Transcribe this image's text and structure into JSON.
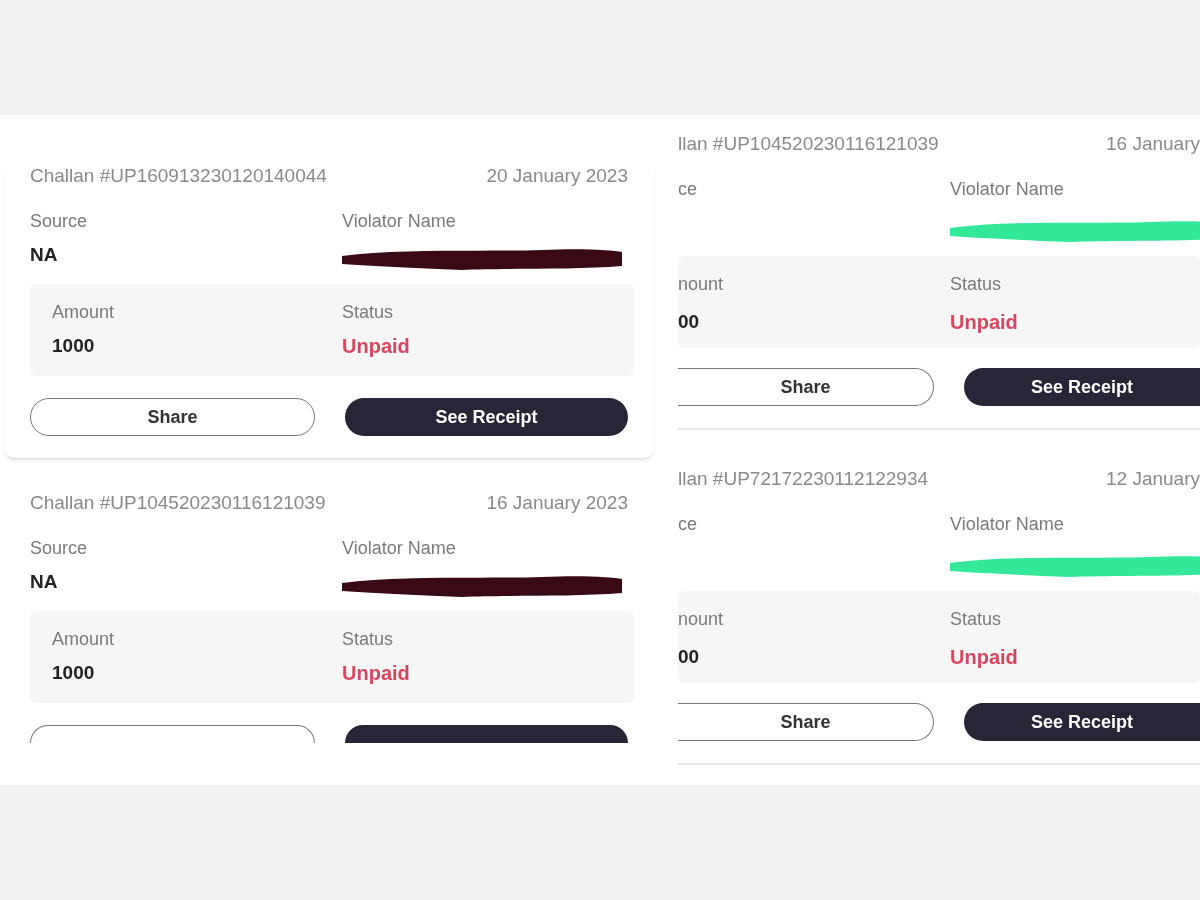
{
  "panels": [
    {
      "kind": "left",
      "color": "#3a0a14",
      "cards": [
        {
          "kind": "full",
          "challan": "Challan #UP160913230120140044",
          "date": "20 January 2023",
          "source_label": "Source",
          "source": "NA",
          "violator_label": "Violator Name",
          "amount_label": "Amount",
          "amount": "1000",
          "status_label": "Status",
          "status": "Unpaid",
          "buttons": [
            "Share",
            "See Receipt"
          ]
        },
        {
          "kind": "partial",
          "challan": "Challan #UP104520230116121039",
          "date": "16 January 2023",
          "source_label": "Source",
          "source": "NA",
          "violator_label": "Violator Name",
          "amount_label": "Amount",
          "amount": "1000",
          "status_label": "Status",
          "status": "Unpaid"
        }
      ]
    },
    {
      "kind": "right",
      "color": "#34e89a",
      "cards": [
        {
          "kind": "full",
          "challan": "llan #UP104520230116121039",
          "date": "16 January",
          "source_label": "ce",
          "violator_label": "Violator Name",
          "amount_label": "nount",
          "amount": "00",
          "status_label": "Status",
          "status": "Unpaid",
          "buttons": [
            "Share",
            "See Receipt"
          ]
        },
        {
          "kind": "full",
          "challan": "llan #UP72172230112122934",
          "date": "12 January",
          "source_label": "ce",
          "violator_label": "Violator Name",
          "amount_label": "nount",
          "amount": "00",
          "status_label": "Status",
          "status": "Unpaid",
          "buttons": [
            "Share",
            "See Receipt"
          ]
        }
      ]
    }
  ]
}
